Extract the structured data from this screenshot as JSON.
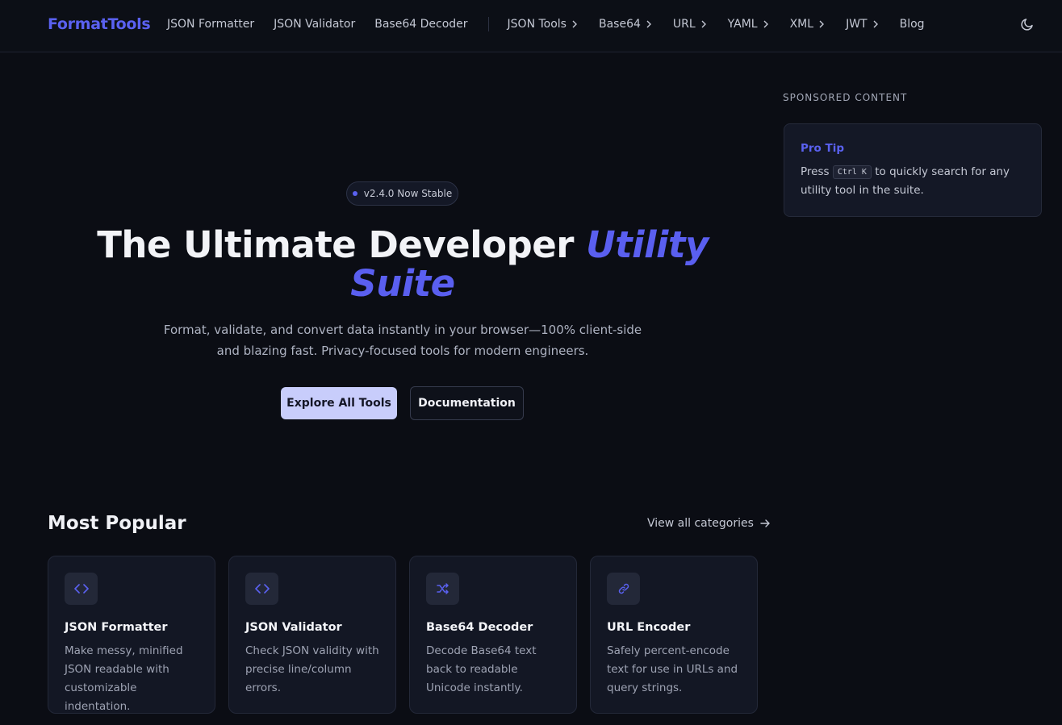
{
  "nav": {
    "logo": "FormatTools",
    "links": [
      "JSON Formatter",
      "JSON Validator",
      "Base64 Decoder"
    ],
    "dropdowns": [
      "JSON Tools",
      "Base64",
      "URL",
      "YAML",
      "XML",
      "JWT"
    ],
    "blog": "Blog",
    "theme_icon": "moon-icon"
  },
  "hero": {
    "badge": "v2.4.0 Now Stable",
    "title_main": "The Ultimate Developer ",
    "title_accent_1": "Utility",
    "title_accent_2": "Suite",
    "subtitle": "Format, validate, and convert data instantly in your browser—100% client-side and blazing fast. Privacy-focused tools for modern engineers.",
    "primary_button": "Explore All Tools",
    "secondary_button": "Documentation"
  },
  "popular": {
    "title": "Most Popular",
    "view_all": "View all categories",
    "cards": [
      {
        "icon": "code-brackets-icon",
        "title": "JSON Formatter",
        "desc": "Make messy, minified JSON readable with customizable indentation."
      },
      {
        "icon": "code-brackets-icon",
        "title": "JSON Validator",
        "desc": "Check JSON validity with precise line/column errors."
      },
      {
        "icon": "shuffle-icon",
        "title": "Base64 Decoder",
        "desc": "Decode Base64 text back to readable Unicode instantly."
      },
      {
        "icon": "link-icon",
        "title": "URL Encoder",
        "desc": "Safely percent-encode text for use in URLs and query strings."
      }
    ]
  },
  "sidebar": {
    "sponsored_label": "SPONSORED CONTENT",
    "tip_title": "Pro Tip",
    "tip_press": "Press",
    "tip_kbd": "Ctrl K",
    "tip_rest": "to quickly search for any utility tool in the suite."
  },
  "colors": {
    "background": "#0b0d14",
    "accent": "#5a61f0",
    "primary_button": "#c8cdfb"
  }
}
